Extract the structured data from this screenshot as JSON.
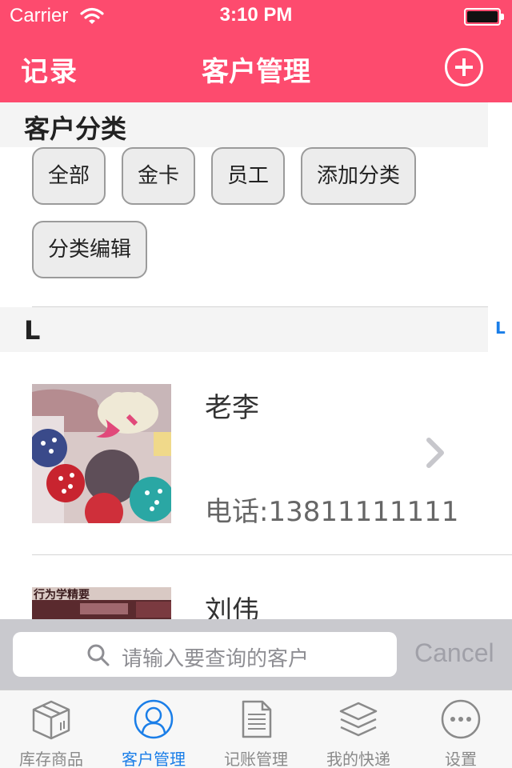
{
  "status_bar": {
    "carrier": "Carrier",
    "time": "3:10 PM"
  },
  "nav": {
    "left_label": "记录",
    "title": "客户管理",
    "add_icon": "plus-circle-icon"
  },
  "categories": {
    "header": "客户分类",
    "chips": [
      "全部",
      "金卡",
      "员工",
      "添加分类",
      "分类编辑"
    ]
  },
  "section_index": {
    "letter": "L",
    "sidebar_letter": "L"
  },
  "customers": [
    {
      "name": "老李",
      "phone": "电话:13811111111"
    },
    {
      "name": "刘伟",
      "phone": ""
    }
  ],
  "search": {
    "placeholder": "请输入要查询的客户",
    "cancel_label": "Cancel"
  },
  "tabs": [
    {
      "label": "库存商品",
      "icon": "box-icon",
      "active": false
    },
    {
      "label": "客户管理",
      "icon": "user-icon",
      "active": true
    },
    {
      "label": "记账管理",
      "icon": "document-icon",
      "active": false
    },
    {
      "label": "我的快递",
      "icon": "layers-icon",
      "active": false
    },
    {
      "label": "设置",
      "icon": "more-icon",
      "active": false
    }
  ],
  "colors": {
    "brand": "#fd4b6e",
    "tab_active": "#1a7ee8",
    "tab_inactive": "#8a8a8a"
  }
}
